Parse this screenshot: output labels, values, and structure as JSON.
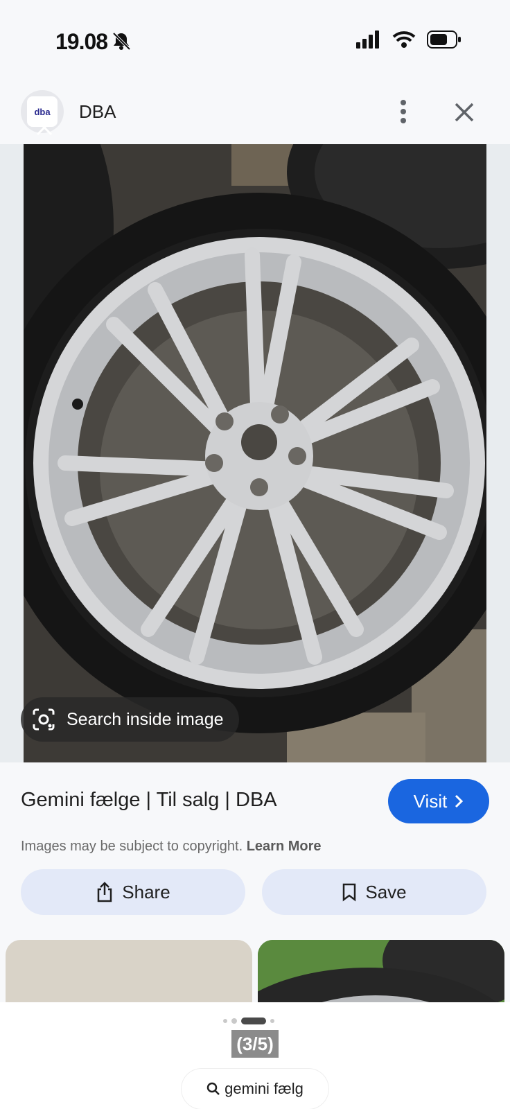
{
  "status_bar": {
    "time": "19.08"
  },
  "header": {
    "site_logo_text": "dba",
    "site_name": "DBA"
  },
  "image_viewer": {
    "search_inside_label": "Search inside image"
  },
  "result": {
    "title": "Gemini fælge | Til salg | DBA",
    "visit_label": "Visit",
    "copyright_text": "Images may be subject to copyright.",
    "learn_more_label": "Learn More",
    "share_label": "Share",
    "save_label": "Save"
  },
  "pager": {
    "counter": "(3/5)",
    "query": "gemini fælg"
  },
  "colors": {
    "accent": "#1a66e0",
    "pill_background": "#e3e9f8"
  }
}
